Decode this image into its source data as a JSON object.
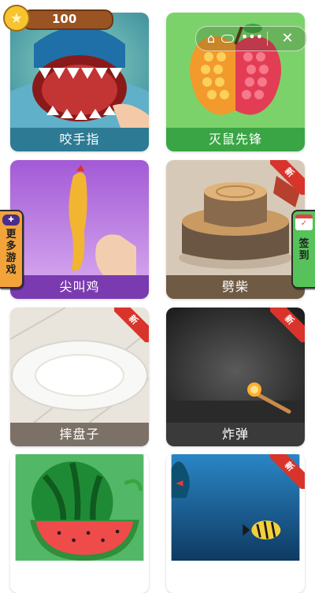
{
  "coins": {
    "value": "100",
    "icon": "star-coin-icon"
  },
  "capsule": {
    "home_icon": "home-icon",
    "more_icon": "more-dots-icon",
    "close_icon": "close-icon"
  },
  "games": [
    {
      "label": "咬手指",
      "color": "#2c7a93",
      "badge": ""
    },
    {
      "label": "灭鼠先锋",
      "color": "#3aa545",
      "badge": ""
    },
    {
      "label": "尖叫鸡",
      "color": "#7a3bb0",
      "badge": ""
    },
    {
      "label": "劈柴",
      "color": "#6f5a44",
      "badge": "新"
    },
    {
      "label": "摔盘子",
      "color": "#7b7166",
      "badge": "新"
    },
    {
      "label": "炸弹",
      "color": "#3a3a3a",
      "badge": "新"
    },
    {
      "label": "",
      "color": "#3cae4f",
      "badge": ""
    },
    {
      "label": "",
      "color": "#1b5b86",
      "badge": "新"
    }
  ],
  "side_left": {
    "label": "更多游戏",
    "icon": "gamepad-icon",
    "color": "#f2a33a"
  },
  "side_right": {
    "label": "签到",
    "icon": "calendar-icon",
    "color": "#57c25a"
  }
}
